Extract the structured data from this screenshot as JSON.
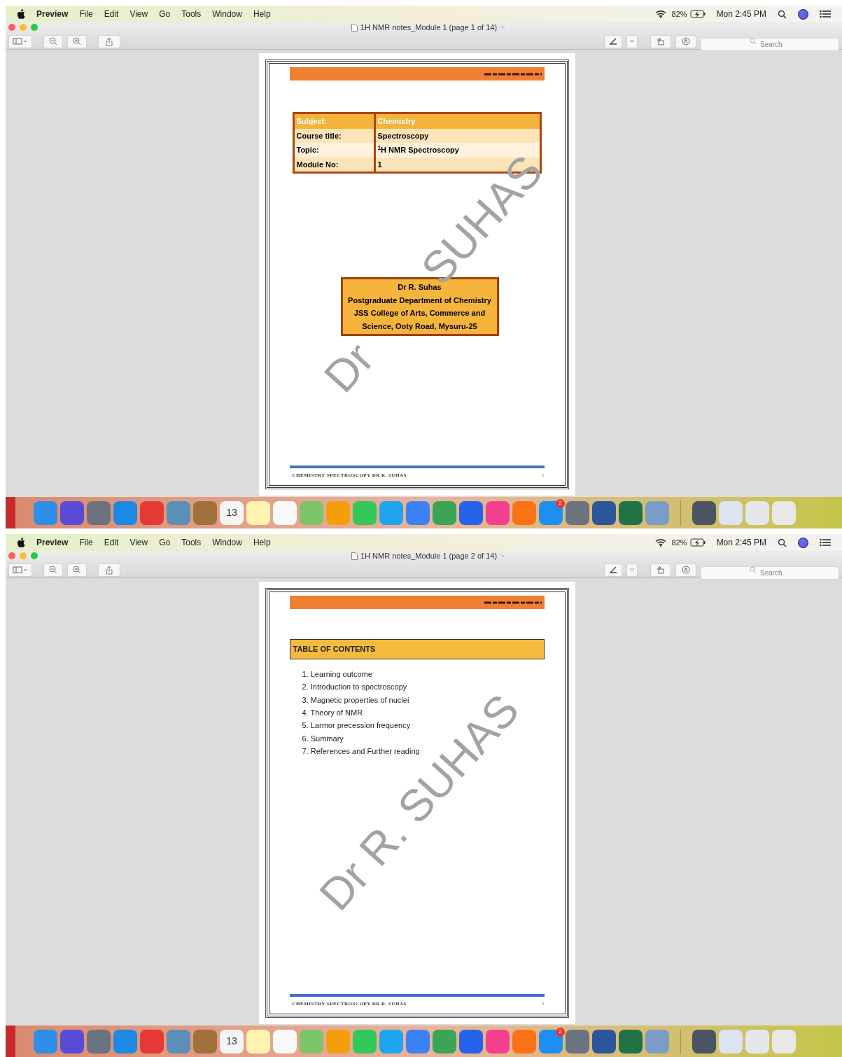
{
  "screens": [
    {
      "menu_bar": {
        "app": "Preview",
        "menus": [
          "File",
          "Edit",
          "View",
          "Go",
          "Tools",
          "Window",
          "Help"
        ],
        "battery": "82%",
        "clock": "Mon 2:45 PM"
      },
      "window": {
        "title": "1H NMR notes_Module 1 (page 1 of 14)",
        "search": {
          "placeholder": "Search"
        }
      },
      "page": {
        "kind": "cover",
        "watermark": [
          "Dr",
          "SUHAS"
        ],
        "info_table": [
          {
            "label": "Subject:",
            "value": "Chemistry"
          },
          {
            "label": "Course title:",
            "value": "Spectroscopy"
          },
          {
            "label": "Topic:",
            "value": "$^{1}$H NMR Spectroscopy"
          },
          {
            "label": "Module No:",
            "value": "1"
          }
        ],
        "author_box": [
          "Dr R. Suhas",
          "Postgraduate Department of Chemistry",
          "JSS College of Arts, Commerce and",
          "Science, Ooty Road, Mysuru-25"
        ],
        "footer": "CHEMISTRY SPECTROSCOPY DR R. SUHAS",
        "page_number": "1"
      },
      "dock": [
        {
          "kind": "app",
          "color": "#2f8fe8"
        },
        {
          "kind": "app",
          "color": "#5a4bd6"
        },
        {
          "kind": "app",
          "color": "#6b7280"
        },
        {
          "kind": "app",
          "color": "#1e88e5"
        },
        {
          "kind": "app",
          "color": "#e53935"
        },
        {
          "kind": "app",
          "color": "#5c8fb8"
        },
        {
          "kind": "app",
          "color": "#a0713b"
        },
        {
          "kind": "app",
          "color": "#f5f5f5",
          "label": "13"
        },
        {
          "kind": "app",
          "color": "#fff3b0"
        },
        {
          "kind": "app",
          "color": "#f8f8f8"
        },
        {
          "kind": "app",
          "color": "#7cc46a"
        },
        {
          "kind": "app",
          "color": "#f59e0b"
        },
        {
          "kind": "app",
          "color": "#34c759"
        },
        {
          "kind": "app",
          "color": "#1fa4f0"
        },
        {
          "kind": "app",
          "color": "#3b82f6"
        },
        {
          "kind": "app",
          "color": "#3aa655"
        },
        {
          "kind": "app",
          "color": "#2563eb"
        },
        {
          "kind": "app",
          "color": "#f43f8e"
        },
        {
          "kind": "app",
          "color": "#f97316"
        },
        {
          "kind": "app",
          "color": "#1d8ff0",
          "badge": "2"
        },
        {
          "kind": "app",
          "color": "#6b7280"
        },
        {
          "kind": "app",
          "color": "#2b579a"
        },
        {
          "kind": "app",
          "color": "#217346"
        },
        {
          "kind": "app",
          "color": "#7a9cc6"
        },
        {
          "kind": "separator"
        },
        {
          "kind": "app",
          "color": "#4b5563"
        },
        {
          "kind": "app",
          "color": "#dbe4f0"
        },
        {
          "kind": "app",
          "color": "#e5e7eb"
        },
        {
          "kind": "app",
          "color": "#e8e8e8"
        }
      ]
    },
    {
      "menu_bar": {
        "app": "Preview",
        "menus": [
          "File",
          "Edit",
          "View",
          "Go",
          "Tools",
          "Window",
          "Help"
        ],
        "battery": "82%",
        "clock": "Mon 2:45 PM"
      },
      "window": {
        "title": "1H NMR notes_Module 1 (page 2 of 14)",
        "search": {
          "placeholder": "Search"
        }
      },
      "page": {
        "kind": "toc",
        "watermark": [
          "Dr R. SUHAS"
        ],
        "heading": "TABLE OF CONTENTS",
        "contents": [
          "1. Learning outcome",
          "2. Introduction to spectroscopy",
          "3. Magnetic properties of nuclei",
          "4. Theory of NMR",
          "5. Larmor precession frequency",
          "6. Summary",
          "7. References and Further reading"
        ],
        "footer": "CHEMISTRY SPECTROSCOPY DR R. SUHAS",
        "page_number": "2"
      },
      "dock": [
        {
          "kind": "app",
          "color": "#2f8fe8"
        },
        {
          "kind": "app",
          "color": "#5a4bd6"
        },
        {
          "kind": "app",
          "color": "#6b7280"
        },
        {
          "kind": "app",
          "color": "#1e88e5"
        },
        {
          "kind": "app",
          "color": "#e53935"
        },
        {
          "kind": "app",
          "color": "#5c8fb8"
        },
        {
          "kind": "app",
          "color": "#a0713b"
        },
        {
          "kind": "app",
          "color": "#f5f5f5",
          "label": "13"
        },
        {
          "kind": "app",
          "color": "#fff3b0"
        },
        {
          "kind": "app",
          "color": "#f8f8f8"
        },
        {
          "kind": "app",
          "color": "#7cc46a"
        },
        {
          "kind": "app",
          "color": "#f59e0b"
        },
        {
          "kind": "app",
          "color": "#34c759"
        },
        {
          "kind": "app",
          "color": "#1fa4f0"
        },
        {
          "kind": "app",
          "color": "#3b82f6"
        },
        {
          "kind": "app",
          "color": "#3aa655"
        },
        {
          "kind": "app",
          "color": "#2563eb"
        },
        {
          "kind": "app",
          "color": "#f43f8e"
        },
        {
          "kind": "app",
          "color": "#f97316"
        },
        {
          "kind": "app",
          "color": "#1d8ff0",
          "badge": "2"
        },
        {
          "kind": "app",
          "color": "#6b7280"
        },
        {
          "kind": "app",
          "color": "#2b579a"
        },
        {
          "kind": "app",
          "color": "#217346"
        },
        {
          "kind": "app",
          "color": "#7a9cc6"
        },
        {
          "kind": "separator"
        },
        {
          "kind": "app",
          "color": "#4b5563"
        },
        {
          "kind": "app",
          "color": "#dbe4f0"
        },
        {
          "kind": "app",
          "color": "#e5e7eb"
        },
        {
          "kind": "app",
          "color": "#e8e8e8"
        }
      ]
    }
  ]
}
